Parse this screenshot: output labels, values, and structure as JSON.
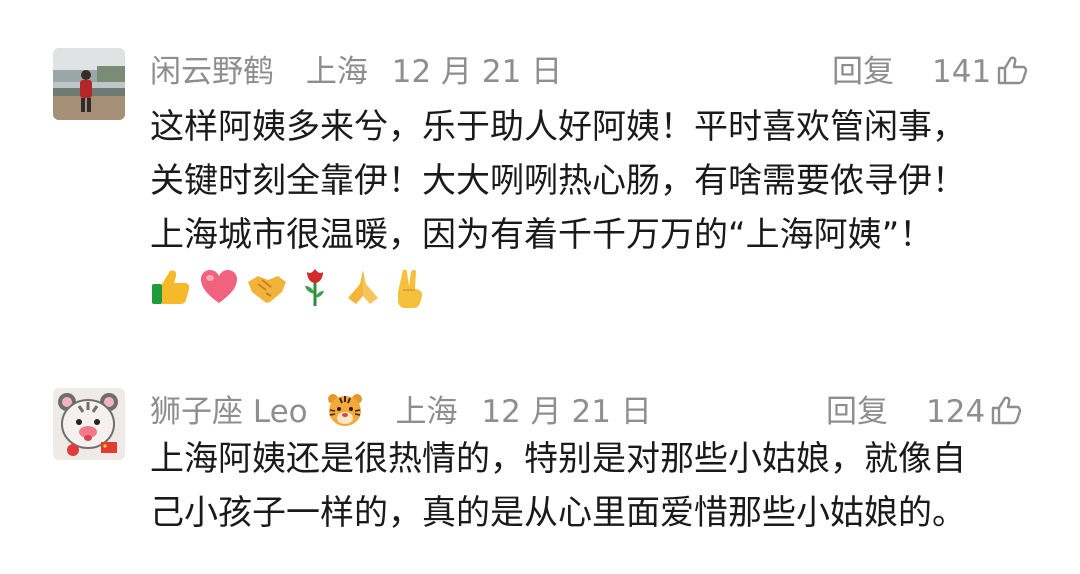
{
  "comments": [
    {
      "username": "闲云野鹤",
      "location": "上海",
      "date": "12 月 21 日",
      "reply_label": "回复",
      "likes": "141",
      "text_lines": [
        "这样阿姨多来兮，乐于助人好阿姨！平时喜欢管闲事，",
        "关键时刻全靠伊！大大咧咧热心肠，有啥需要侬寻伊！",
        "上海城市很温暖，因为有着千千万万的“上海阿姨”！"
      ],
      "emojis": [
        "thumbs-up-icon",
        "heart-icon",
        "handshake-icon",
        "rose-icon",
        "pray-hands-icon",
        "victory-hand-icon"
      ]
    },
    {
      "username": "狮子座 Leo",
      "username_emoji": "tiger-face-icon",
      "location": "上海",
      "date": "12 月 21 日",
      "reply_label": "回复",
      "likes": "124",
      "text_lines": [
        "上海阿姨还是很热情的，特别是对那些小姑娘，就像自",
        "己小孩子一样的，真的是从心里面爱惜那些小姑娘的。"
      ]
    }
  ],
  "colors": {
    "meta_gray": "#8e8e8e",
    "body_text": "#1a1a1a",
    "background": "#ffffff"
  }
}
